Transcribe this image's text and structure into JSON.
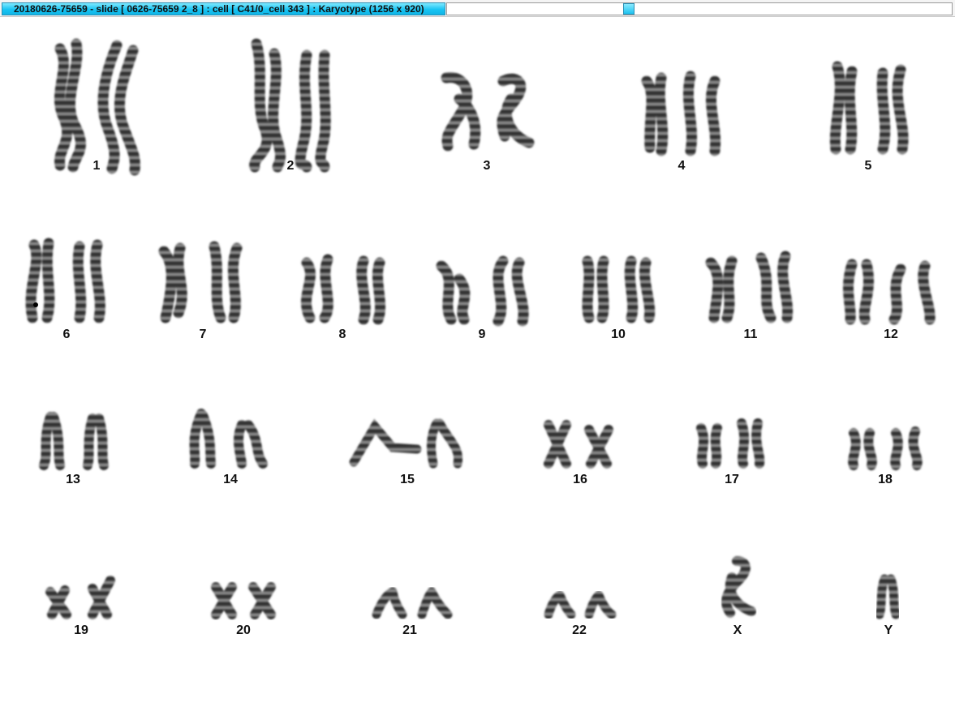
{
  "window": {
    "title": "20180626-75659 - slide [ 0626-75659 2_8 ] : cell [ C41/0_cell 343 ] : Karyotype  (1256 x 920)"
  },
  "karyotype": {
    "chromosome_labels": [
      "1",
      "2",
      "3",
      "4",
      "5",
      "6",
      "7",
      "8",
      "9",
      "10",
      "11",
      "12",
      "13",
      "14",
      "15",
      "16",
      "17",
      "18",
      "19",
      "20",
      "21",
      "22",
      "X",
      "Y"
    ]
  }
}
